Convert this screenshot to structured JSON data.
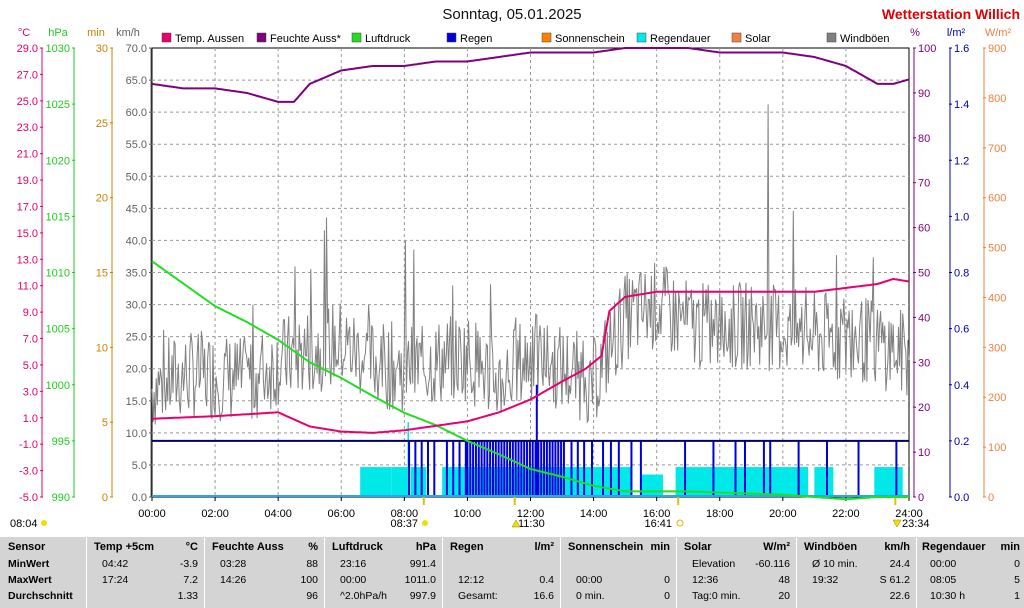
{
  "header": {
    "title": "Sonntag, 05.01.2025",
    "station": "Wetterstation Willich"
  },
  "legend": [
    {
      "label": "Temp. Aussen",
      "color": "#e8006e"
    },
    {
      "label": "Feuchte Auss*",
      "color": "#800080"
    },
    {
      "label": "Luftdruck",
      "color": "#22dd22"
    },
    {
      "label": "Regen",
      "color": "#0000dd"
    },
    {
      "label": "Sonnenschein",
      "color": "#ff8000"
    },
    {
      "label": "Regendauer",
      "color": "#00e8e8"
    },
    {
      "label": "Solar",
      "color": "#f08040"
    },
    {
      "label": "Windböen",
      "color": "#808080"
    }
  ],
  "axes": {
    "temp": {
      "unit": "°C",
      "color": "#e8006e",
      "ticks": [
        "29.0",
        "27.0",
        "25.0",
        "23.0",
        "21.0",
        "19.0",
        "17.0",
        "15.0",
        "13.0",
        "11.0",
        "9.0",
        "7.0",
        "5.0",
        "3.0",
        "1.0",
        "-1.0",
        "-3.0",
        "-5.0"
      ]
    },
    "pressure": {
      "unit": "hPa",
      "color": "#22cc22",
      "ticks": [
        "1030",
        "1025",
        "1020",
        "1015",
        "1010",
        "1005",
        "1000",
        "995",
        "990"
      ]
    },
    "minutes": {
      "unit": "min",
      "color": "#d08000",
      "ticks": [
        "30",
        "25",
        "20",
        "15",
        "10",
        "5",
        "0"
      ]
    },
    "wind": {
      "unit": "km/h",
      "color": "#606060",
      "ticks": [
        "70.0",
        "65.0",
        "60.0",
        "55.0",
        "50.0",
        "45.0",
        "40.0",
        "35.0",
        "30.0",
        "25.0",
        "20.0",
        "15.0",
        "10.0",
        "5.0",
        "0.0"
      ]
    },
    "humidity": {
      "unit": "%",
      "color": "#800080",
      "ticks": [
        "100",
        "90",
        "80",
        "70",
        "60",
        "50",
        "40",
        "30",
        "20",
        "10",
        "0"
      ]
    },
    "rain": {
      "unit": "l/m²",
      "color": "#0000aa",
      "ticks": [
        "1.6",
        "1.4",
        "1.2",
        "1.0",
        "0.8",
        "0.6",
        "0.4",
        "0.2",
        "0.0"
      ]
    },
    "solar": {
      "unit": "W/m²",
      "color": "#f08040",
      "ticks": [
        "900",
        "800",
        "700",
        "600",
        "500",
        "400",
        "300",
        "200",
        "100",
        "0"
      ]
    },
    "time": {
      "ticks": [
        "00:00",
        "02:00",
        "04:00",
        "06:00",
        "08:00",
        "10:00",
        "12:00",
        "14:00",
        "16:00",
        "18:00",
        "20:00",
        "22:00",
        "24:00"
      ]
    }
  },
  "sun_markers": {
    "left_time": "08:04",
    "sunrise": "08:37",
    "noon": "11:30",
    "sunset": "16:41",
    "right_time": "23:34"
  },
  "chart_data": {
    "type": "line",
    "title": "Sonntag, 05.01.2025",
    "x_range": [
      "00:00",
      "24:00"
    ],
    "series": [
      {
        "name": "Temp. Aussen",
        "unit": "°C",
        "ylim": [
          -5,
          30
        ],
        "x": [
          "00:00",
          "02:00",
          "04:00",
          "05:00",
          "06:00",
          "07:00",
          "08:00",
          "10:00",
          "11:00",
          "12:00",
          "13:00",
          "13:45",
          "14:15",
          "14:30",
          "15:00",
          "16:00",
          "17:00",
          "18:00",
          "20:00",
          "21:00",
          "22:00",
          "23:00",
          "23:30",
          "24:00"
        ],
        "values": [
          1.1,
          1.3,
          1.6,
          0.5,
          0.1,
          0.0,
          0.2,
          0.9,
          1.6,
          2.6,
          4.0,
          5.0,
          6.0,
          9.5,
          10.6,
          11.0,
          11.0,
          11.0,
          11.0,
          11.0,
          11.3,
          11.6,
          12.0,
          11.8
        ]
      },
      {
        "name": "Feuchte Auss*",
        "unit": "%",
        "ylim": [
          0,
          100
        ],
        "x": [
          "00:00",
          "01:00",
          "02:00",
          "03:00",
          "04:00",
          "04:30",
          "05:00",
          "06:00",
          "07:00",
          "08:00",
          "09:00",
          "10:00",
          "11:00",
          "12:00",
          "13:00",
          "14:00",
          "15:00",
          "16:00",
          "17:00",
          "18:00",
          "19:00",
          "20:00",
          "21:00",
          "22:00",
          "23:00",
          "23:30",
          "24:00"
        ],
        "values": [
          92,
          91,
          91,
          90,
          88,
          88,
          92,
          95,
          96,
          96,
          97,
          97,
          98,
          99,
          99,
          99,
          100,
          100,
          100,
          99,
          99,
          99,
          98,
          96,
          92,
          92,
          93
        ]
      },
      {
        "name": "Luftdruck",
        "unit": "hPa",
        "ylim": [
          990,
          1030
        ],
        "x": [
          "00:00",
          "01:00",
          "02:00",
          "03:00",
          "04:00",
          "05:00",
          "06:00",
          "07:00",
          "08:00",
          "09:00",
          "10:00",
          "11:00",
          "12:00",
          "13:00",
          "14:00",
          "15:00",
          "16:00",
          "17:00",
          "18:00",
          "19:00",
          "20:00",
          "21:00",
          "22:00",
          "23:00",
          "24:00"
        ],
        "values": [
          1011.0,
          1009.0,
          1007.0,
          1005.6,
          1004.0,
          1002.0,
          1000.6,
          999.0,
          997.5,
          996.4,
          995.0,
          993.8,
          992.5,
          991.8,
          991.0,
          990.5,
          990.5,
          990.5,
          990.4,
          990.3,
          990.2,
          990.0,
          989.8,
          990.0,
          990.0
        ]
      },
      {
        "name": "Windböen",
        "unit": "km/h",
        "ylim": [
          0,
          70
        ],
        "mean": 22.6,
        "max": 61.2,
        "x": [
          "00:00",
          "01:00",
          "02:00",
          "03:00",
          "04:00",
          "05:00",
          "06:00",
          "07:00",
          "08:00",
          "09:00",
          "10:00",
          "11:00",
          "12:00",
          "13:00",
          "14:00",
          "15:00",
          "16:00",
          "17:00",
          "18:00",
          "19:00",
          "20:00",
          "21:00",
          "22:00",
          "23:00",
          "24:00"
        ],
        "values": [
          17,
          19,
          19,
          18,
          21,
          23,
          24,
          21,
          20,
          21,
          22,
          18,
          22,
          20,
          18,
          28,
          30,
          27,
          26,
          27,
          26,
          25,
          25,
          24,
          22
        ]
      },
      {
        "name": "Regen",
        "unit": "l/m²",
        "ylim": [
          0,
          1.6
        ],
        "total": 16.6,
        "max": 0.4
      },
      {
        "name": "Regendauer",
        "unit": "min",
        "ylim": [
          0,
          30
        ],
        "total": 1
      }
    ]
  },
  "footer": [
    {
      "header": "Sensor",
      "unit": "",
      "rows": [
        {
          "time": "MinWert",
          "value": ""
        },
        {
          "time": "MaxWert",
          "value": ""
        },
        {
          "time": "Durchschnitt",
          "value": ""
        }
      ]
    },
    {
      "header": "Temp +5cm",
      "unit": "°C",
      "rows": [
        {
          "time": "04:42",
          "value": "-3.9"
        },
        {
          "time": "17:24",
          "value": "7.2"
        },
        {
          "time": "",
          "value": "1.33"
        }
      ]
    },
    {
      "header": "Feuchte Auss",
      "unit": "%",
      "rows": [
        {
          "time": "03:28",
          "value": "88"
        },
        {
          "time": "14:26",
          "value": "100"
        },
        {
          "time": "",
          "value": "96"
        }
      ]
    },
    {
      "header": "Luftdruck",
      "unit": "hPa",
      "rows": [
        {
          "time": "23:16",
          "value": "991.4"
        },
        {
          "time": "00:00",
          "value": "1011.0"
        },
        {
          "time": "^2.0hPa/h",
          "value": "997.9"
        }
      ]
    },
    {
      "header": "Regen",
      "unit": "l/m²",
      "rows": [
        {
          "time": "",
          "value": ""
        },
        {
          "time": "12:12",
          "value": "0.4"
        },
        {
          "time": "Gesamt:",
          "value": "16.6"
        }
      ]
    },
    {
      "header": "Sonnenschein",
      "unit": "min",
      "rows": [
        {
          "time": "",
          "value": ""
        },
        {
          "time": "00:00",
          "value": "0"
        },
        {
          "time": "0 min.",
          "value": "0"
        }
      ]
    },
    {
      "header": "Solar",
      "unit": "W/m²",
      "rows": [
        {
          "time": "Elevation",
          "value": "-60.116"
        },
        {
          "time": "12:36",
          "value": "48"
        },
        {
          "time": "Tag:0 min.",
          "value": "20"
        }
      ]
    },
    {
      "header": "Windböen",
      "unit": "km/h",
      "rows": [
        {
          "time": "Ø 10 min.",
          "value": "24.4"
        },
        {
          "time": "19:32",
          "value": "S 61.2"
        },
        {
          "time": "",
          "value": "22.6"
        }
      ]
    },
    {
      "header": "Regendauer",
      "unit": "min",
      "rows": [
        {
          "time": "00:00",
          "value": "0"
        },
        {
          "time": "08:05",
          "value": "5"
        },
        {
          "time": "10:30 h",
          "value": "1"
        }
      ]
    }
  ]
}
